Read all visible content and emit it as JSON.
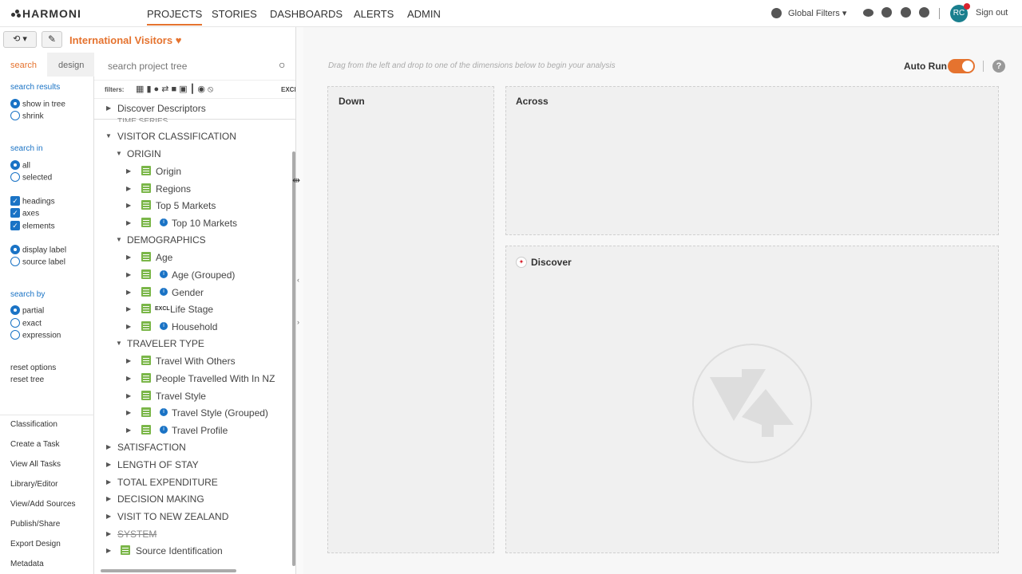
{
  "app": {
    "name": "HARMONI"
  },
  "nav": [
    "PROJECTS",
    "STORIES",
    "DASHBOARDS",
    "ALERTS",
    "ADMIN"
  ],
  "topright": {
    "global_filters": "Global Filters",
    "avatar": "RC",
    "signout": "Sign out"
  },
  "project": {
    "title": "International Visitors"
  },
  "tabs": {
    "search": "search",
    "design": "design"
  },
  "left": {
    "search_results": "search results",
    "show_in_tree": "show in tree",
    "shrink": "shrink",
    "search_in": "search in",
    "all": "all",
    "selected": "selected",
    "headings": "headings",
    "axes": "axes",
    "elements": "elements",
    "display_label": "display label",
    "source_label": "source label",
    "search_by": "search by",
    "partial": "partial",
    "exact": "exact",
    "expression": "expression",
    "reset_options": "reset options",
    "reset_tree": "reset tree",
    "links": [
      "Classification",
      "Create a Task",
      "View All Tasks",
      "Library/Editor",
      "View/Add Sources",
      "Publish/Share",
      "Export Design",
      "Metadata"
    ]
  },
  "tree": {
    "search_placeholder": "search project tree",
    "filters_label": "filters:",
    "excl": "EXCL",
    "discover": "Discover Descriptors",
    "time_series": "TIME SERIES",
    "items": [
      {
        "label": "VISITOR CLASSIFICATION"
      },
      {
        "label": "ORIGIN"
      },
      {
        "label": "Origin"
      },
      {
        "label": "Regions"
      },
      {
        "label": "Top 5 Markets"
      },
      {
        "label": "Top 10 Markets"
      },
      {
        "label": "DEMOGRAPHICS"
      },
      {
        "label": "Age"
      },
      {
        "label": "Age (Grouped)"
      },
      {
        "label": "Gender"
      },
      {
        "label": "Life Stage"
      },
      {
        "label": "Household"
      },
      {
        "label": "TRAVELER TYPE"
      },
      {
        "label": "Travel With Others"
      },
      {
        "label": "People Travelled With In NZ"
      },
      {
        "label": "Travel Style"
      },
      {
        "label": "Travel Style (Grouped)"
      },
      {
        "label": "Travel Profile"
      },
      {
        "label": "SATISFACTION"
      },
      {
        "label": "LENGTH OF STAY"
      },
      {
        "label": "TOTAL EXPENDITURE"
      },
      {
        "label": "DECISION MAKING"
      },
      {
        "label": "VISIT TO NEW ZEALAND"
      },
      {
        "label": "SYSTEM"
      },
      {
        "label": "Source Identification"
      }
    ]
  },
  "main": {
    "hint": "Drag from the left and drop to one of the dimensions below to begin your analysis",
    "autorun": "Auto Run",
    "help": "?",
    "down": "Down",
    "across": "Across",
    "discover": "Discover"
  }
}
